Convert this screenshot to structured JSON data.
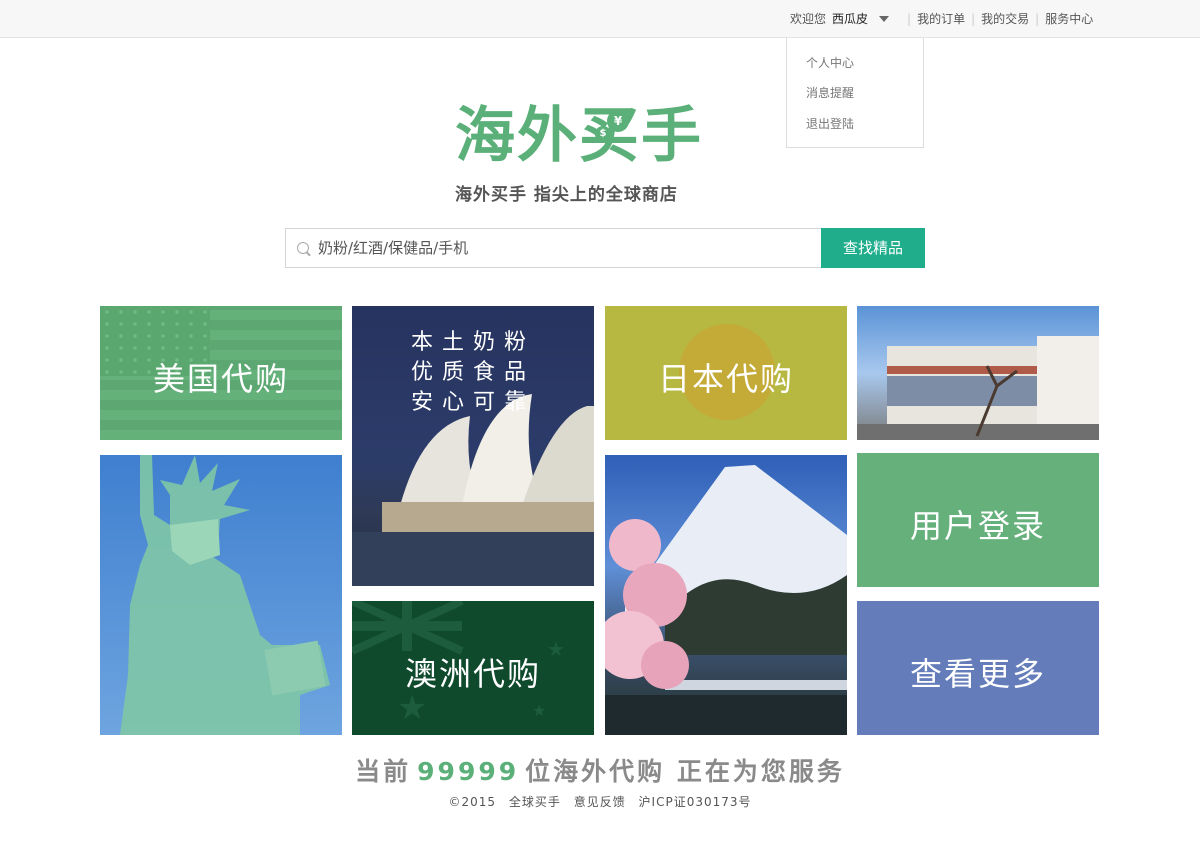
{
  "topbar": {
    "welcome": "欢迎您",
    "username": "西瓜皮",
    "links": [
      "我的订单",
      "我的交易",
      "服务中心"
    ]
  },
  "user_menu": {
    "items": [
      "个人中心",
      "消息提醒",
      "退出登陆"
    ]
  },
  "logo": {
    "title": "海外买手",
    "coin_yen": "¥",
    "coin_dollar": "$",
    "tagline": "海外买手 指尖上的全球商店"
  },
  "search": {
    "placeholder": "奶粉/红酒/保健品/手机",
    "button": "查找精品"
  },
  "tiles": {
    "usa": "美国代购",
    "milk": [
      "本土奶粉",
      "优质食品",
      "安心可靠"
    ],
    "japan": "日本代购",
    "australia": "澳洲代购",
    "login": "用户登录",
    "more": "查看更多"
  },
  "stat": {
    "prefix": "当前",
    "count": "99999",
    "suffix": "位海外代购 正在为您服务"
  },
  "footer": {
    "copyright": "©2015",
    "brand": "全球买手",
    "feedback": "意见反馈",
    "icp": "沪ICP证030173号"
  }
}
